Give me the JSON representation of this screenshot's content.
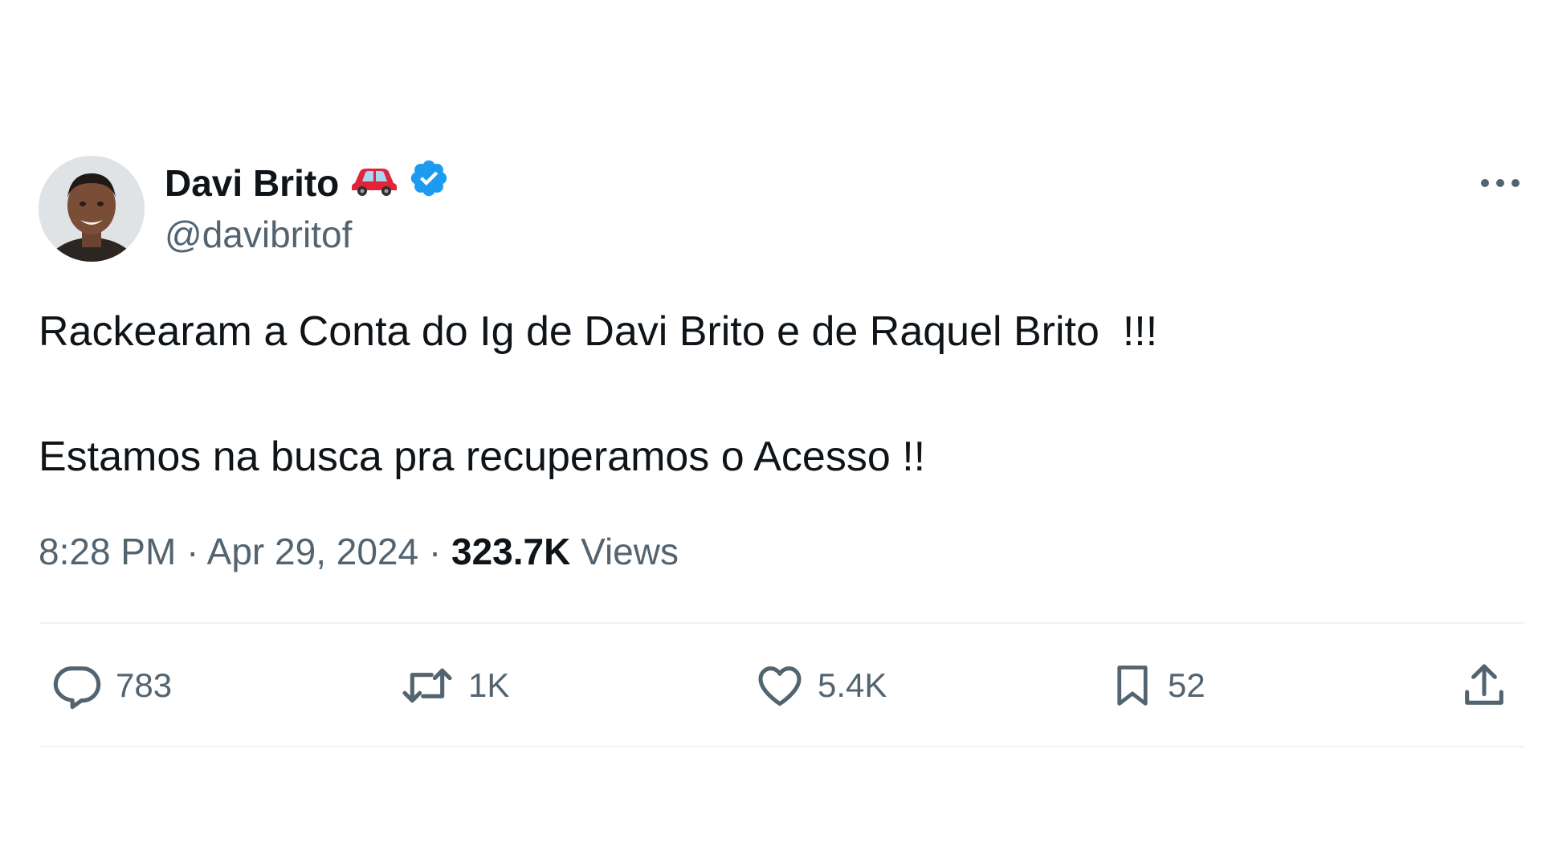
{
  "author": {
    "display_name": "Davi Brito",
    "handle": "@davibritof",
    "verified": true,
    "name_emoji": "car-icon"
  },
  "tweet": {
    "lines": [
      "Rackearam a Conta do Ig de Davi Brito e de Raquel Brito  !!!",
      "Estamos na busca pra recuperamos o Acesso !!"
    ],
    "time": "8:28 PM",
    "date": "Apr 29, 2024",
    "separator": "·",
    "views_count": "323.7K",
    "views_label": "Views"
  },
  "actions": {
    "replies": "783",
    "retweets": "1K",
    "likes": "5.4K",
    "bookmarks": "52"
  },
  "colors": {
    "verified": "#1d9bf0",
    "secondary_text": "#536471",
    "divider": "#eff3f4",
    "car": "#e0243a"
  }
}
